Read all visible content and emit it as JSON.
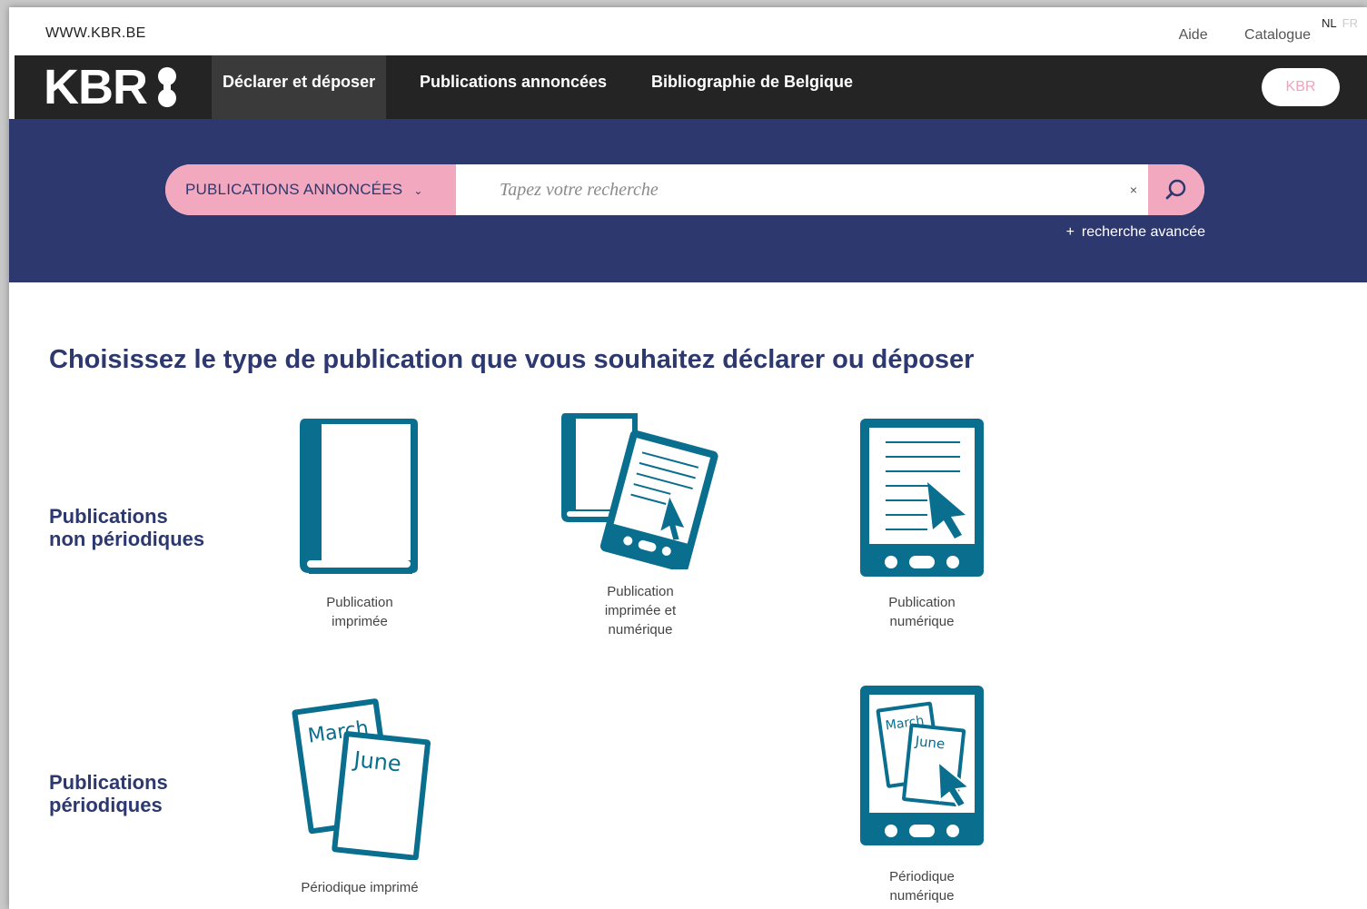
{
  "utility": {
    "site": "WWW.KBR.BE",
    "help": "Aide",
    "catalogue": "Catalogue",
    "lang_nl": "NL",
    "lang_fr": "FR"
  },
  "nav": {
    "logo": "KBR",
    "items": [
      "Déclarer et déposer",
      "Publications annoncées",
      "Bibliographie de Belgique"
    ],
    "account_button": "KBR"
  },
  "search": {
    "scope": "PUBLICATIONS ANNONCÉES",
    "placeholder": "Tapez votre recherche",
    "clear": "×",
    "advanced": "recherche avancée",
    "advanced_prefix": "+"
  },
  "main": {
    "heading": "Choisissez le type de publication que vous souhaitez déclarer ou déposer",
    "rows": [
      {
        "label": "Publications\nnon périodiques",
        "cards": [
          {
            "caption": "Publication\nimprimée",
            "icon": "printed-book-icon"
          },
          {
            "caption": "Publication\nimprimée et\nnumérique",
            "icon": "book-and-tablet-icon"
          },
          {
            "caption": "Publication\nnumérique",
            "icon": "digital-tablet-icon"
          }
        ]
      },
      {
        "label": "Publications\npériodiques",
        "cards": [
          {
            "caption": "Périodique imprimé",
            "icon": "printed-periodical-icon"
          },
          {
            "caption": "Périodique\nnumérique",
            "icon": "digital-periodical-icon"
          }
        ]
      }
    ],
    "periodical_months": [
      "March",
      "June"
    ]
  },
  "colors": {
    "navy": "#2c386e",
    "pink": "#f2a9bf",
    "teal": "#0a6e8e",
    "dark": "#242424"
  }
}
